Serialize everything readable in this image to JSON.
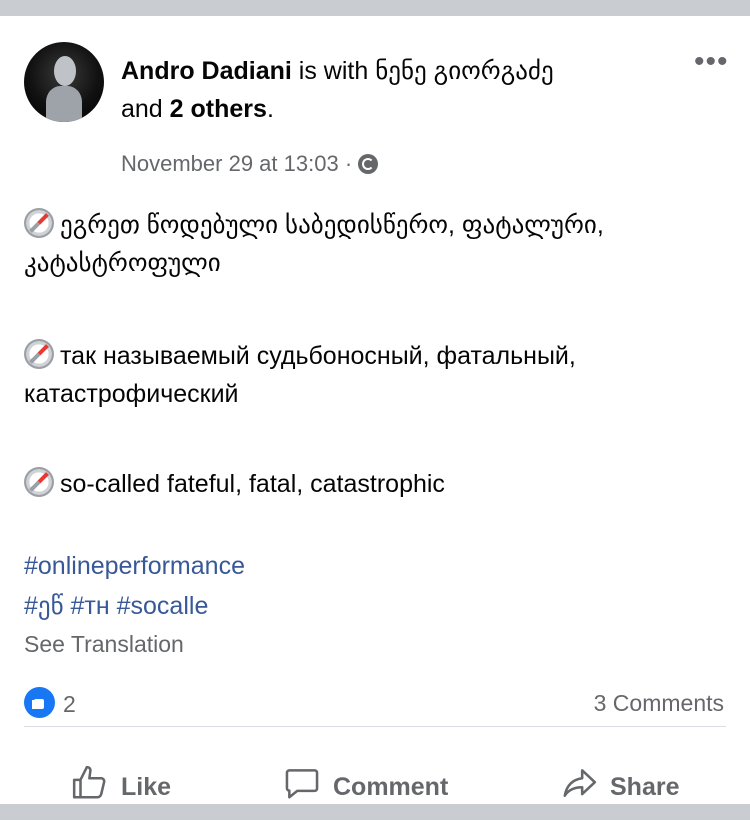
{
  "post": {
    "author": "Andro Dadiani",
    "with_text": "is with",
    "tagged_user": "ნენე გიორგაძე",
    "and_text": "and",
    "others_text": "2 others",
    "period": ".",
    "timestamp": "November 29 at 13:03",
    "meta_separator": "·",
    "privacy_icon": "globe-icon",
    "more_icon": "more-options-icon",
    "paragraphs": [
      "ეგრეთ წოდებული საბედისწერო, ფატალური, კატასტროფული",
      "так называемый судьбоносный, фатальный, катастрофический",
      "so-called fateful, fatal, catastrophic"
    ],
    "paragraph_icon": "compass-icon",
    "hashtags_line1": "#onlineperformance",
    "hashtags_line2": [
      "#ეწ",
      "#тн",
      "#socalle"
    ],
    "see_translation": "See Translation"
  },
  "reactions": {
    "like_count": "2",
    "comments_label": "3 Comments",
    "like_icon": "thumbs-up-icon"
  },
  "actions": {
    "like": "Like",
    "comment": "Comment",
    "share": "Share"
  },
  "colors": {
    "link": "#385898",
    "secondary_text": "#65676b",
    "like_blue": "#1877f2"
  }
}
